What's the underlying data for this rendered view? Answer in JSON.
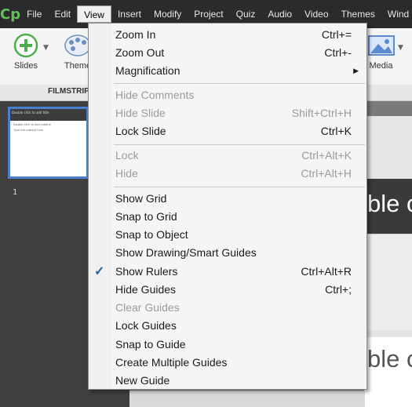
{
  "app": {
    "logo_text": "Cp",
    "menubar": [
      "File",
      "Edit",
      "View",
      "Insert",
      "Modify",
      "Project",
      "Quiz",
      "Audio",
      "Video",
      "Themes",
      "Wind"
    ],
    "active_menu": "View"
  },
  "toolbar": {
    "slides_label": "Slides",
    "themes_label": "Theme",
    "media_label": "Media",
    "filmstrip_label": "FILMSTRIP"
  },
  "filmstrip": {
    "thumb_title": "Double click to add title",
    "thumb_subtitle": "Double click to add subtitle",
    "thumb_body": "Type the subtext here",
    "slide_number": "1"
  },
  "canvas": {
    "text_line_1": "ble c",
    "text_line_2": "ble c"
  },
  "view_menu": {
    "items": [
      {
        "label": "Zoom In",
        "shortcut": "Ctrl+=",
        "enabled": true
      },
      {
        "label": "Zoom Out",
        "shortcut": "Ctrl+-",
        "enabled": true
      },
      {
        "label": "Magnification",
        "shortcut": "",
        "enabled": true,
        "submenu": true
      },
      {
        "label": "Hide Comments",
        "shortcut": "",
        "enabled": false
      },
      {
        "label": "Hide Slide",
        "shortcut": "Shift+Ctrl+H",
        "enabled": false
      },
      {
        "label": "Lock Slide",
        "shortcut": "Ctrl+K",
        "enabled": true
      },
      {
        "label": "Lock",
        "shortcut": "Ctrl+Alt+K",
        "enabled": false
      },
      {
        "label": "Hide",
        "shortcut": "Ctrl+Alt+H",
        "enabled": false
      },
      {
        "label": "Show Grid",
        "shortcut": "",
        "enabled": true
      },
      {
        "label": "Snap to Grid",
        "shortcut": "",
        "enabled": true
      },
      {
        "label": "Snap to Object",
        "shortcut": "",
        "enabled": true
      },
      {
        "label": "Show Drawing/Smart Guides",
        "shortcut": "",
        "enabled": true
      },
      {
        "label": "Show Rulers",
        "shortcut": "Ctrl+Alt+R",
        "enabled": true,
        "checked": true
      },
      {
        "label": "Hide Guides",
        "shortcut": "Ctrl+;",
        "enabled": true
      },
      {
        "label": "Clear Guides",
        "shortcut": "",
        "enabled": false
      },
      {
        "label": "Lock Guides",
        "shortcut": "",
        "enabled": true
      },
      {
        "label": "Snap to Guide",
        "shortcut": "",
        "enabled": true
      },
      {
        "label": "Create Multiple Guides",
        "shortcut": "",
        "enabled": true
      },
      {
        "label": "New Guide",
        "shortcut": "",
        "enabled": true
      }
    ]
  },
  "colors": {
    "accent": "#4a7fd0",
    "logo": "#5fc25a",
    "check": "#2a5fa8"
  }
}
